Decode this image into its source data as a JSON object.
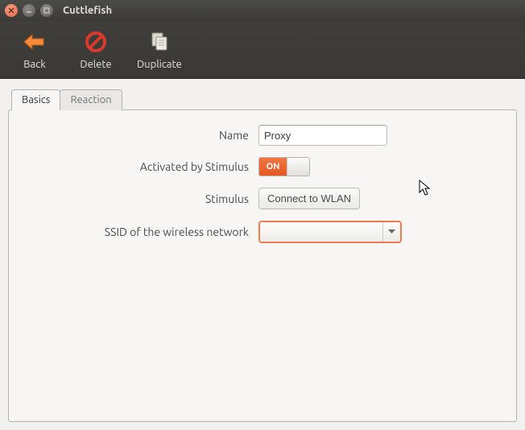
{
  "window": {
    "title": "Cuttlefish"
  },
  "toolbar": {
    "back": "Back",
    "delete": "Delete",
    "duplicate": "Duplicate"
  },
  "tabs": {
    "basics": "Basics",
    "reaction": "Reaction",
    "active": "basics"
  },
  "form": {
    "name_label": "Name",
    "name_value": "Proxy",
    "activated_label": "Activated by Stimulus",
    "activated_state": "ON",
    "stimulus_label": "Stimulus",
    "stimulus_value": "Connect to WLAN",
    "ssid_label": "SSID of the wireless network",
    "ssid_value": ""
  },
  "colors": {
    "accent": "#e2571e"
  }
}
